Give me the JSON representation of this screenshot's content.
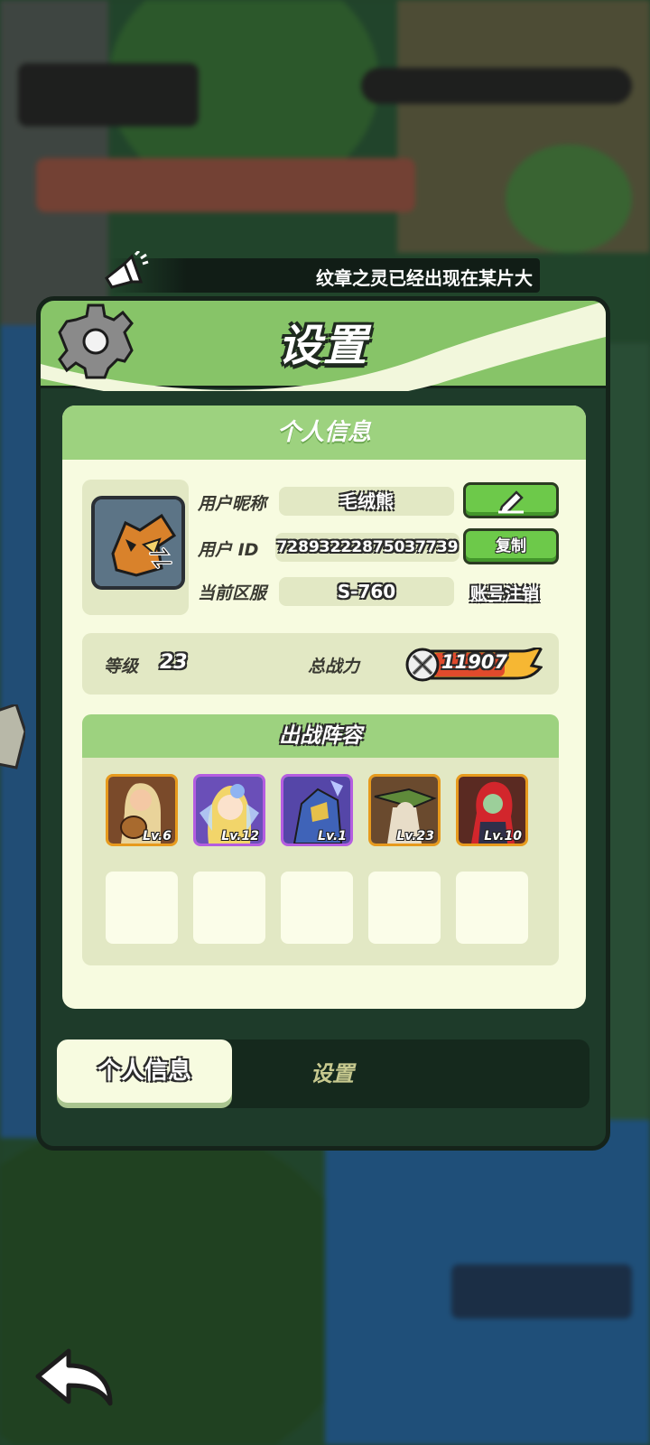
{
  "banner": {
    "text": "纹章之灵已经出现在某片大"
  },
  "panel": {
    "title": "设置"
  },
  "profile": {
    "section_title": "个人信息",
    "nickname_label": "用户昵称",
    "nickname": "毛绒熊",
    "id_label": "用户  ID",
    "user_id": "7289322287503773​9",
    "copy_label": "复制",
    "server_label": "当前区服",
    "server": "S-760",
    "cancel_account_label": "账号注销"
  },
  "stats": {
    "level_label": "等级",
    "level": "23",
    "power_label": "总战力",
    "power": "11907"
  },
  "lineup": {
    "title": "出战阵容",
    "heroes": [
      {
        "level": "Lv.6",
        "rarity": "gold"
      },
      {
        "level": "Lv.12",
        "rarity": "purple"
      },
      {
        "level": "Lv.1",
        "rarity": "purple"
      },
      {
        "level": "Lv.23",
        "rarity": "gold"
      },
      {
        "level": "Lv.10",
        "rarity": "gold"
      }
    ]
  },
  "tabs": {
    "active": "个人信息",
    "inactive": "设置"
  },
  "colors": {
    "accent_green": "#87c468",
    "card_bg": "#f7fbe0",
    "panel_dark": "#1e3b2a",
    "gold_frame": "#e79a1d",
    "purple_frame": "#b45de0"
  },
  "icons": [
    "megaphone-icon",
    "gear-icon",
    "edit-pencil-icon",
    "swap-icon",
    "crossed-swords-icon",
    "back-arrow-icon"
  ]
}
